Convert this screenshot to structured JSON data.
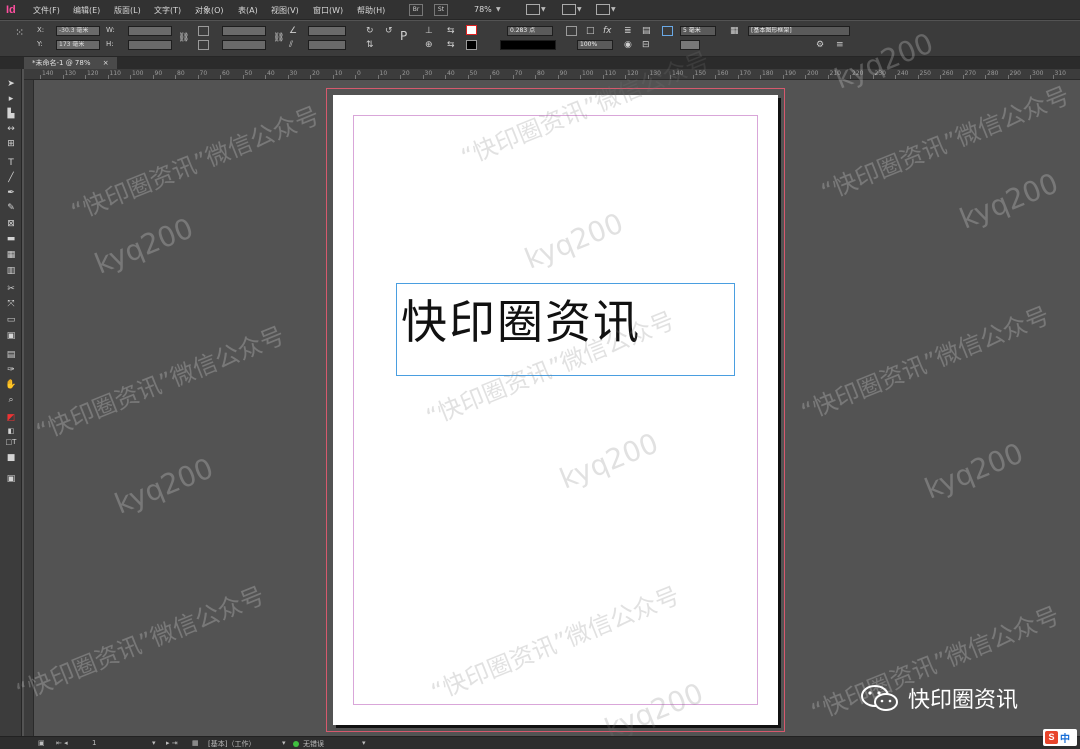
{
  "app": {
    "icon_label": "Id"
  },
  "menubar": {
    "items": [
      "文件(F)",
      "编辑(E)",
      "版面(L)",
      "文字(T)",
      "对象(O)",
      "表(A)",
      "视图(V)",
      "窗口(W)",
      "帮助(H)"
    ],
    "bridge_label": "Br",
    "stock_label": "St",
    "zoom": "78%"
  },
  "control_panel": {
    "x_label": "X:",
    "y_label": "Y:",
    "w_label": "W:",
    "h_label": "H:",
    "x_value": "-30.3 毫米",
    "y_value": "173 毫米",
    "stroke_weight": "0.283 点",
    "opacity": "100%",
    "spacing": "5 毫米",
    "object_style": "[基本图形框架]"
  },
  "document_tab": {
    "title": "*未命名-1 @ 78%",
    "close": "×"
  },
  "ruler": {
    "labels": [
      "140",
      "130",
      "120",
      "110",
      "100",
      "90",
      "80",
      "70",
      "60",
      "50",
      "40",
      "30",
      "20",
      "10",
      "0",
      "10",
      "20",
      "30",
      "40",
      "50",
      "60",
      "70",
      "80",
      "90",
      "100",
      "110",
      "120",
      "130",
      "140",
      "150",
      "160",
      "170",
      "180",
      "190",
      "200",
      "210",
      "220",
      "230",
      "240",
      "250",
      "260",
      "270",
      "280",
      "290",
      "300",
      "310"
    ]
  },
  "text_frame": {
    "content": "快印圈资讯"
  },
  "statusbar": {
    "page": "1",
    "master": "[基本]（工作）",
    "preflight": "无错误"
  },
  "watermarks": {
    "handle": "kyq200",
    "account": "“快印圈资讯”微信公众号"
  },
  "brand": {
    "name": "快印圈资讯"
  },
  "ime": {
    "logo": "S",
    "lang": "中"
  },
  "colors": {
    "bleed": "#d6596d",
    "margin": "#d9a6d9",
    "frame": "#4a9ee0",
    "app_icon": "#ff4fa0"
  }
}
